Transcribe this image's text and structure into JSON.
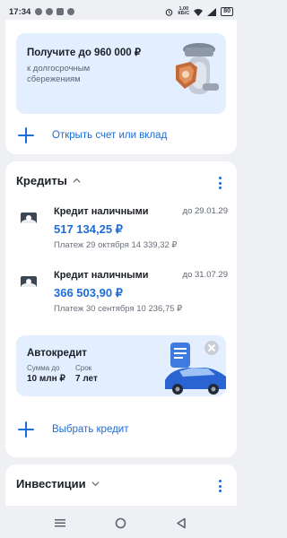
{
  "status_bar": {
    "time": "17:34",
    "net_speed_value": "1,00",
    "net_speed_unit": "КБ/С",
    "battery": "80"
  },
  "savings_card": {
    "promo_title": "Получите до 960 000 ₽",
    "promo_subtitle_line1": "к долгосрочным",
    "promo_subtitle_line2": "сбережениям",
    "open_account_label": "Открыть счет или вклад"
  },
  "credits_card": {
    "title": "Кредиты",
    "loans": [
      {
        "name": "Кредит наличными",
        "due_date": "до 29.01.29",
        "amount": "517 134,25 ₽",
        "payment": "Платеж 29 октября 14 339,32 ₽"
      },
      {
        "name": "Кредит наличными",
        "due_date": "до 31.07.29",
        "amount": "366 503,90 ₽",
        "payment": "Платеж 30 сентября 10 236,75 ₽"
      }
    ],
    "auto_promo": {
      "title": "Автокредит",
      "sum_label": "Сумма до",
      "sum_value": "10 млн ₽",
      "term_label": "Срок",
      "term_value": "7 лет"
    },
    "choose_credit_label": "Выбрать кредит"
  },
  "investments_card": {
    "title": "Инвестиции"
  },
  "colors": {
    "accent": "#1d6cd8",
    "promo_bg": "#e3efff",
    "page_bg": "#eef0f3"
  }
}
